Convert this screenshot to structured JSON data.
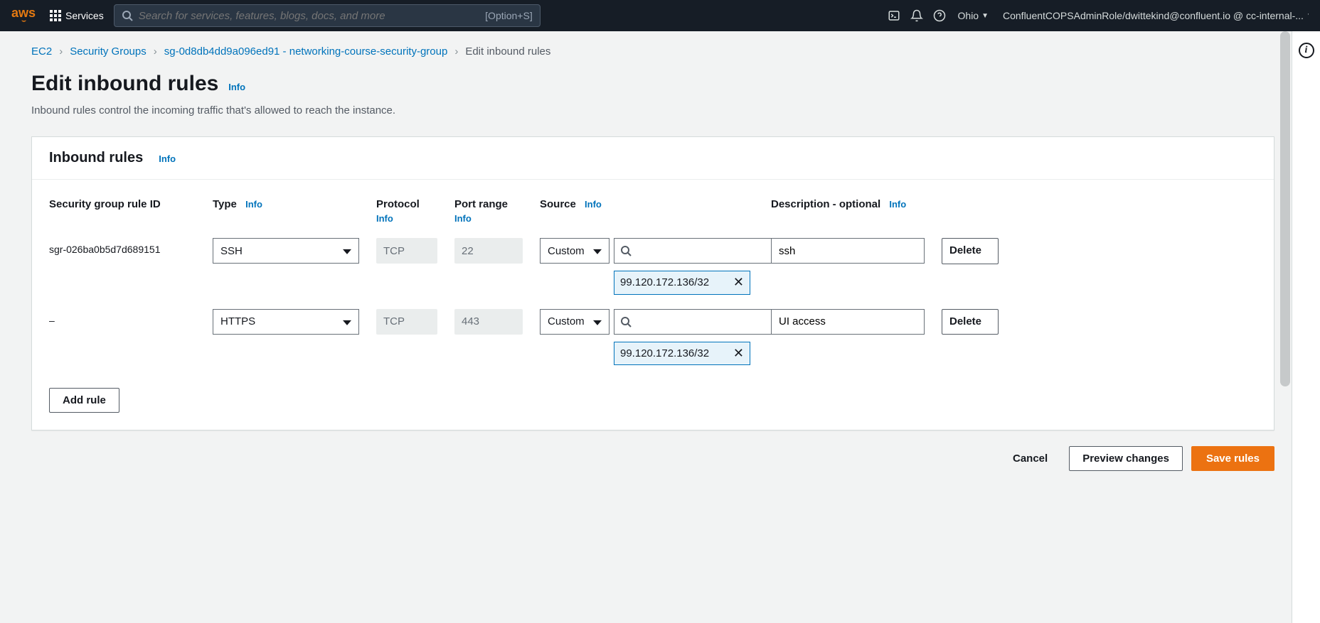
{
  "nav": {
    "services_label": "Services",
    "search_placeholder": "Search for services, features, blogs, docs, and more",
    "search_hint": "[Option+S]",
    "region": "Ohio",
    "account": "ConfluentCOPSAdminRole/dwittekind@confluent.io @ cc-internal-..."
  },
  "breadcrumb": {
    "items": [
      "EC2",
      "Security Groups",
      "sg-0d8db4dd9a096ed91 - networking-course-security-group"
    ],
    "current": "Edit inbound rules"
  },
  "page": {
    "title": "Edit inbound rules",
    "title_info": "Info",
    "desc": "Inbound rules control the incoming traffic that's allowed to reach the instance."
  },
  "panel": {
    "title": "Inbound rules",
    "title_info": "Info",
    "columns": {
      "rule_id": "Security group rule ID",
      "type": "Type",
      "type_info": "Info",
      "protocol": "Protocol",
      "protocol_info": "Info",
      "port": "Port range",
      "port_info": "Info",
      "source": "Source",
      "source_info": "Info",
      "desc": "Description - optional",
      "desc_info": "Info"
    },
    "rules": [
      {
        "id": "sgr-026ba0b5d7d689151",
        "type": "SSH",
        "protocol": "TCP",
        "port": "22",
        "source_mode": "Custom",
        "source_cidr": "99.120.172.136/32",
        "description": "ssh",
        "delete_label": "Delete"
      },
      {
        "id": "–",
        "type": "HTTPS",
        "protocol": "TCP",
        "port": "443",
        "source_mode": "Custom",
        "source_cidr": "99.120.172.136/32",
        "description": "UI access",
        "delete_label": "Delete"
      }
    ],
    "add_rule_label": "Add rule"
  },
  "footer": {
    "cancel": "Cancel",
    "preview": "Preview changes",
    "save": "Save rules"
  }
}
